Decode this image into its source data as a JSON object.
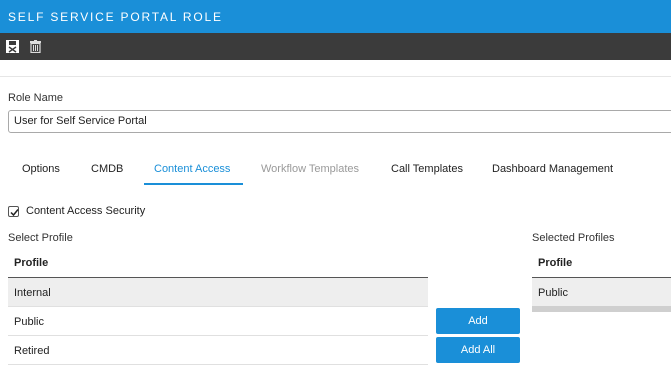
{
  "header": {
    "title": "SELF SERVICE PORTAL ROLE"
  },
  "toolbar": {
    "icons": [
      "save-icon",
      "trash-icon"
    ]
  },
  "role_name": {
    "label": "Role Name",
    "value": "User for Self Service Portal"
  },
  "tabs": [
    {
      "label": "Options",
      "state": "normal"
    },
    {
      "label": "CMDB",
      "state": "normal"
    },
    {
      "label": "Content Access",
      "state": "active"
    },
    {
      "label": "Workflow Templates",
      "state": "disabled"
    },
    {
      "label": "Call Templates",
      "state": "normal"
    },
    {
      "label": "Dashboard Management",
      "state": "normal"
    }
  ],
  "content_access": {
    "checkbox_label": "Content Access Security",
    "checked": true
  },
  "select_profile": {
    "label": "Select Profile",
    "column": "Profile",
    "rows": [
      "Internal",
      "Public",
      "Retired"
    ],
    "highlighted_row": "Internal"
  },
  "selected_profiles": {
    "label": "Selected Profiles",
    "column": "Profile",
    "rows": [
      "Public"
    ]
  },
  "buttons": {
    "add": "Add",
    "add_all": "Add All"
  },
  "colors": {
    "accent": "#1a8fd8",
    "toolbar": "#3b3b3b",
    "row_highlight": "#eeeeee"
  }
}
